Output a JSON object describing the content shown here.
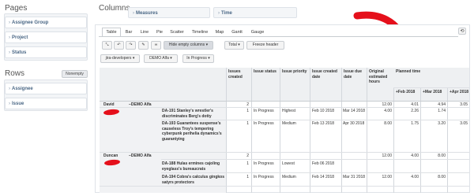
{
  "pages": {
    "title": "Pages",
    "items": [
      "Assignee Group",
      "Project",
      "Status"
    ]
  },
  "rows": {
    "title": "Rows",
    "nonempty_label": "Nonempty",
    "items": [
      "Assignee",
      "Issue"
    ]
  },
  "columns": {
    "title": "Columns",
    "items": [
      "Measures",
      "Time"
    ]
  },
  "tabs": [
    "Table",
    "Bar",
    "Line",
    "Pie",
    "Scatter",
    "Timeline",
    "Map",
    "Gantt",
    "Gauge"
  ],
  "active_tab": "Table",
  "toolbar": {
    "hide_empty_label": "Hide empty columns ▾",
    "total_label": "Total ▾",
    "freeze_label": "Freeze header"
  },
  "filters": [
    "jira-developers ▾",
    "DEMO Alfa ▾",
    "In Progress ▾"
  ],
  "table": {
    "headers": [
      "Issues created",
      "Issue status",
      "Issue priority",
      "Issue created date",
      "Issue due date",
      "Original estimated hours",
      "Planned time"
    ],
    "time_headers": [
      "Feb 2018",
      "Mar 2018",
      "Apr 2018"
    ],
    "rows": [
      {
        "assignee": "David",
        "project": "DEMO Alfa",
        "created": "2",
        "status": "",
        "priority": "",
        "cdate": "",
        "due": "",
        "orig": "12.00",
        "feb": "4.01",
        "mar": "4.94",
        "apr": "3.05"
      },
      {
        "issue": "DA-191 Stanley's wrestler's discriminates Berg's dotty",
        "created": "1",
        "status": "In Progress",
        "priority": "Highest",
        "cdate": "Feb 10 2018",
        "due": "Mar 14 2018",
        "orig": "4.00",
        "feb": "2.26",
        "mar": "1.74",
        "apr": ""
      },
      {
        "issue": "DA-193 Guarantees suspense's causeless Troy's tempering cyberpunk perihelia dynamics's guarantying",
        "created": "1",
        "status": "In Progress",
        "priority": "Medium",
        "cdate": "Feb 13 2018",
        "due": "Apr 30 2018",
        "orig": "8.00",
        "feb": "1.75",
        "mar": "3.20",
        "apr": "3.05"
      },
      {
        "assignee": "Duncan",
        "project": "DEMO Alfa",
        "created": "2",
        "status": "",
        "priority": "",
        "cdate": "",
        "due": "",
        "orig": "12.00",
        "feb": "4.00",
        "mar": "8.00",
        "apr": ""
      },
      {
        "issue": "DA-188 Hulas ermines cajoling eyeglass's bureaucrats",
        "created": "1",
        "status": "In Progress",
        "priority": "Lowest",
        "cdate": "Feb 06 2018",
        "due": "",
        "orig": "",
        "feb": "",
        "mar": "",
        "apr": ""
      },
      {
        "issue": "DA-194 Cobra's calculus gingkos satyrs protectors",
        "created": "1",
        "status": "In Progress",
        "priority": "Medium",
        "cdate": "Feb 14 2018",
        "due": "Mar 31 2018",
        "orig": "12.00",
        "feb": "4.00",
        "mar": "8.00",
        "apr": ""
      }
    ]
  },
  "colors": {
    "accent": "#4a6785",
    "arrow": "#e5101b",
    "header_bg": "#eef0f2"
  }
}
